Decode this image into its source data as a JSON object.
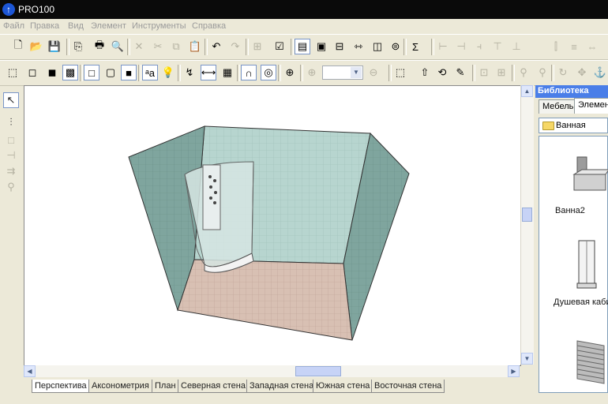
{
  "app": {
    "title": "PRO100",
    "icon_symbol": "↑"
  },
  "menu": [
    "Файл",
    "Правка",
    "Вид",
    "Элемент",
    "Инструменты",
    "Справка"
  ],
  "toolbar1": {
    "buttons": [
      {
        "icon": "new-file-icon",
        "glyph": "🗋",
        "state": "normal"
      },
      {
        "icon": "open-folder-icon",
        "glyph": "📂",
        "state": "normal"
      },
      {
        "icon": "save-icon",
        "glyph": "💾",
        "state": "normal"
      },
      {
        "icon": "export-icon",
        "glyph": "⎘",
        "state": "normal"
      },
      {
        "icon": "print-icon",
        "glyph": "🖶",
        "state": "normal"
      },
      {
        "icon": "print-preview-icon",
        "glyph": "🔍",
        "state": "normal"
      },
      {
        "icon": "delete-icon",
        "glyph": "✕",
        "state": "disabled"
      },
      {
        "icon": "cut-icon",
        "glyph": "✂",
        "state": "disabled"
      },
      {
        "icon": "copy-icon",
        "glyph": "⧉",
        "state": "disabled"
      },
      {
        "icon": "paste-icon",
        "glyph": "📋",
        "state": "disabled"
      },
      {
        "icon": "undo-icon",
        "glyph": "↶",
        "state": "normal"
      },
      {
        "icon": "redo-icon",
        "glyph": "↷",
        "state": "disabled"
      },
      {
        "icon": "properties-icon",
        "glyph": "⊞",
        "state": "disabled"
      },
      {
        "icon": "checklist-icon",
        "glyph": "☑",
        "state": "normal"
      },
      {
        "icon": "library-icon",
        "glyph": "▤",
        "state": "active"
      },
      {
        "icon": "window-icon",
        "glyph": "▣",
        "state": "normal"
      },
      {
        "icon": "window-grid-icon",
        "glyph": "⊟",
        "state": "normal"
      },
      {
        "icon": "dimension-window-icon",
        "glyph": "⇿",
        "state": "normal"
      },
      {
        "icon": "window-layers-icon",
        "glyph": "◫",
        "state": "normal"
      },
      {
        "icon": "cost-window-icon",
        "glyph": "⊜",
        "state": "normal"
      },
      {
        "icon": "sum-icon",
        "glyph": "Σ",
        "state": "normal"
      },
      {
        "icon": "align-left-icon",
        "glyph": "⊢",
        "state": "disabled"
      },
      {
        "icon": "align-center-icon",
        "glyph": "⊣",
        "state": "disabled"
      },
      {
        "icon": "align-right-icon",
        "glyph": "⫞",
        "state": "disabled"
      },
      {
        "icon": "align-top-icon",
        "glyph": "⊤",
        "state": "disabled"
      },
      {
        "icon": "align-bottom-icon",
        "glyph": "⊥",
        "state": "disabled"
      },
      {
        "icon": "distribute-h-icon",
        "glyph": "⫿",
        "state": "disabled"
      },
      {
        "icon": "distribute-v-icon",
        "glyph": "≡",
        "state": "disabled"
      },
      {
        "icon": "same-width-icon",
        "glyph": "⇔",
        "state": "disabled"
      },
      {
        "icon": "same-height-icon",
        "glyph": "⇕",
        "state": "disabled"
      },
      {
        "icon": "same-size-icon",
        "glyph": "⧈",
        "state": "disabled"
      }
    ]
  },
  "toolbar2": {
    "zoom_value": "",
    "buttons": [
      {
        "icon": "wireframe-box-icon",
        "glyph": "⬚",
        "state": "normal"
      },
      {
        "icon": "hidden-line-box-icon",
        "glyph": "◻",
        "state": "normal"
      },
      {
        "icon": "shaded-box-icon",
        "glyph": "◼",
        "state": "normal"
      },
      {
        "icon": "textured-box-icon",
        "glyph": "▩",
        "state": "active"
      },
      {
        "icon": "outline-box-icon",
        "glyph": "□",
        "state": "active"
      },
      {
        "icon": "edges-box-icon",
        "glyph": "▢",
        "state": "normal"
      },
      {
        "icon": "color-box-icon",
        "glyph": "■",
        "state": "active"
      },
      {
        "icon": "font-icon",
        "glyph": "ᵃa",
        "state": "active"
      },
      {
        "icon": "light-bulb-icon",
        "glyph": "💡",
        "state": "normal"
      },
      {
        "icon": "measure-tool-icon",
        "glyph": "↯",
        "state": "normal"
      },
      {
        "icon": "dimension-icon",
        "glyph": "⟷",
        "state": "active"
      },
      {
        "icon": "grid-icon",
        "glyph": "▦",
        "state": "normal"
      },
      {
        "icon": "magnet-icon",
        "glyph": "∩",
        "state": "active"
      },
      {
        "icon": "target-icon",
        "glyph": "◎",
        "state": "active"
      },
      {
        "icon": "crosshair-icon",
        "glyph": "⊕",
        "state": "normal"
      },
      {
        "icon": "zoom-in-icon",
        "glyph": "⊕",
        "state": "disabled"
      },
      {
        "icon": "zoom-out-icon",
        "glyph": "⊖",
        "state": "disabled"
      },
      {
        "icon": "select-all-icon",
        "glyph": "⬚",
        "state": "normal"
      },
      {
        "icon": "move-up-icon",
        "glyph": "⇧",
        "state": "normal"
      },
      {
        "icon": "rotate-3d-icon",
        "glyph": "⟲",
        "state": "normal"
      },
      {
        "icon": "pencil-icon",
        "glyph": "✎",
        "state": "normal"
      },
      {
        "icon": "group-icon",
        "glyph": "⊡",
        "state": "disabled"
      },
      {
        "icon": "ungroup-icon",
        "glyph": "⊞",
        "state": "disabled"
      },
      {
        "icon": "pin-icon",
        "glyph": "⚲",
        "state": "disabled"
      },
      {
        "icon": "pin2-icon",
        "glyph": "⚲",
        "state": "disabled"
      },
      {
        "icon": "rotate-icon",
        "glyph": "↻",
        "state": "disabled"
      },
      {
        "icon": "move-icon",
        "glyph": "✥",
        "state": "disabled"
      },
      {
        "icon": "anchor-icon",
        "glyph": "⚓",
        "state": "disabled"
      }
    ]
  },
  "left_tools": [
    {
      "icon": "pointer-icon",
      "glyph": "↖",
      "state": "active"
    },
    {
      "icon": "wall-tool-icon",
      "glyph": "⫶",
      "state": "normal"
    },
    {
      "icon": "box-tool-icon",
      "glyph": "□",
      "state": "disabled"
    },
    {
      "icon": "split-tool-icon",
      "glyph": "⊣",
      "state": "disabled"
    },
    {
      "icon": "extend-tool-icon",
      "glyph": "⇉",
      "state": "disabled"
    },
    {
      "icon": "zoom-tool-icon",
      "glyph": "⚲",
      "state": "disabled"
    }
  ],
  "view_tabs": [
    "Перспектива",
    "Аксонометрия",
    "План",
    "Северная стена",
    "Западная стена",
    "Южная стена",
    "Восточная стена"
  ],
  "active_view_tab": 0,
  "library": {
    "title": "Библиотека",
    "tabs": [
      "Мебель",
      "Элемен"
    ],
    "active_tab": 1,
    "folder": "Ванная",
    "items": [
      {
        "label": "Ванна2"
      },
      {
        "label": "Душевая каби"
      }
    ]
  },
  "colors": {
    "titlebar": "#0a0a0a",
    "library_header": "#4a7ee8",
    "wall_left": "#7fa59e",
    "wall_back": "#b3d2cc",
    "floor": "#d7bdb0"
  }
}
